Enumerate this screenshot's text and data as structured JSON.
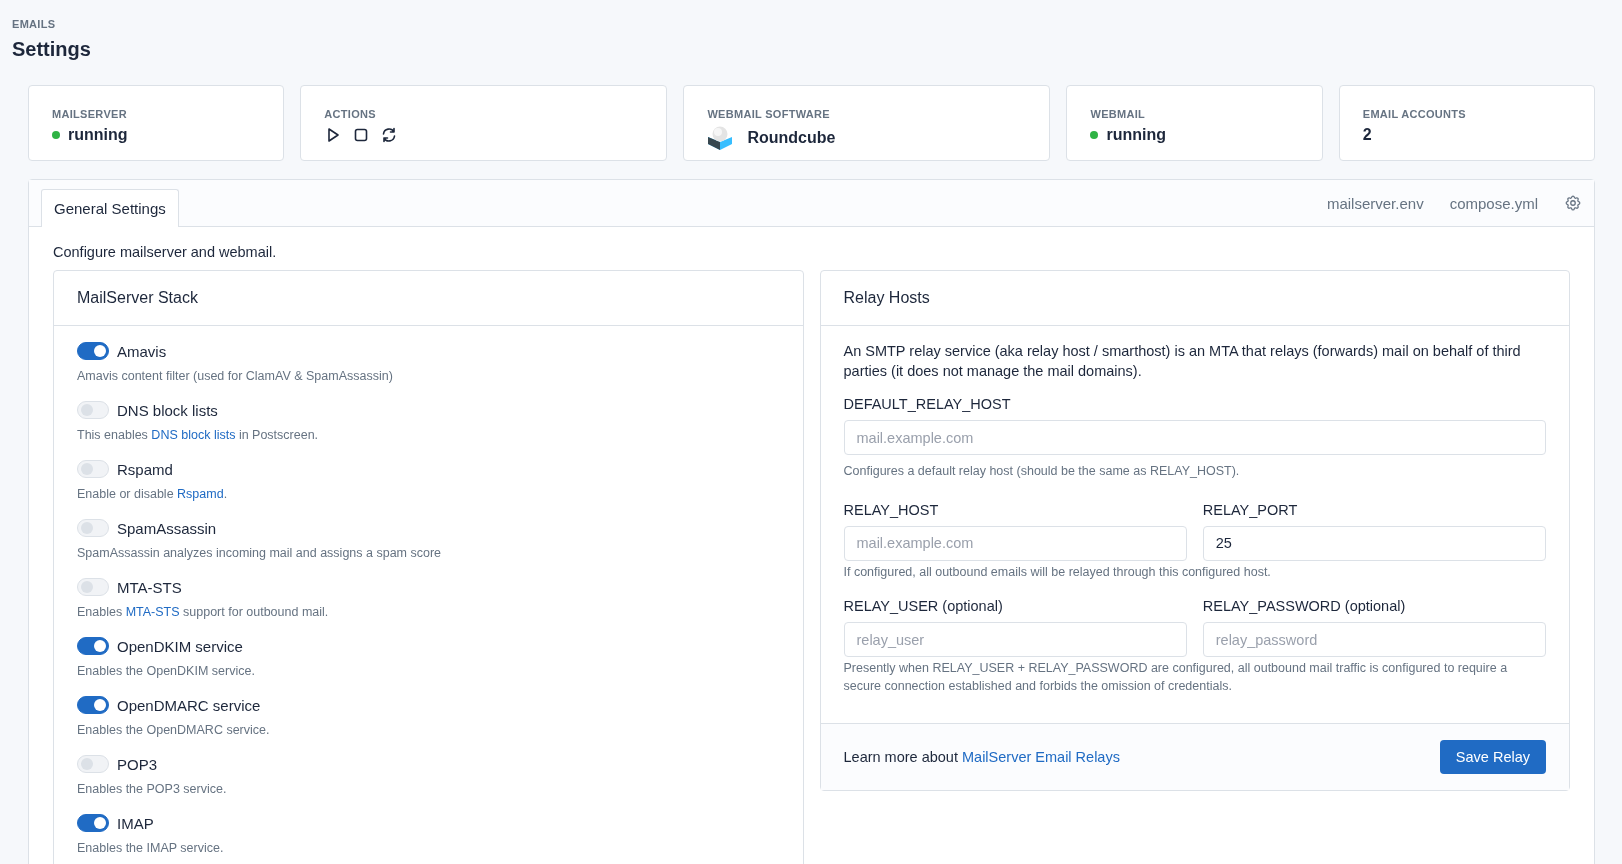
{
  "breadcrumb": "EMAILS",
  "title": "Settings",
  "stats": [
    {
      "kind": "status",
      "label": "MAILSERVER",
      "value": "running",
      "color": "#2fb344"
    },
    {
      "kind": "actions",
      "label": "ACTIONS"
    },
    {
      "kind": "software",
      "label": "WEBMAIL SOFTWARE",
      "value": "Roundcube"
    },
    {
      "kind": "status",
      "label": "WEBMAIL",
      "value": "running",
      "color": "#2fb344"
    },
    {
      "kind": "plain",
      "label": "EMAIL ACCOUNTS",
      "value": "2"
    }
  ],
  "tabs": [
    {
      "label": "General Settings",
      "selected": true
    }
  ],
  "tab_links": [
    "mailserver.env",
    "compose.yml"
  ],
  "intro": "Configure mailserver and webmail.",
  "stack": {
    "title": "MailServer Stack",
    "items": [
      {
        "name": "Amavis",
        "on": true,
        "description": [
          {
            "kind": "text",
            "text": "Amavis content filter (used for ClamAV & SpamAssassin)"
          }
        ]
      },
      {
        "name": "DNS block lists",
        "on": false,
        "description": [
          {
            "kind": "text",
            "text": "This enables "
          },
          {
            "kind": "link",
            "text": "DNS block lists"
          },
          {
            "kind": "text",
            "text": " in Postscreen."
          }
        ]
      },
      {
        "name": "Rspamd",
        "on": false,
        "description": [
          {
            "kind": "text",
            "text": "Enable or disable "
          },
          {
            "kind": "link",
            "text": "Rspamd"
          },
          {
            "kind": "text",
            "text": "."
          }
        ]
      },
      {
        "name": "SpamAssassin",
        "on": false,
        "description": [
          {
            "kind": "text",
            "text": "SpamAssassin analyzes incoming mail and assigns a spam score"
          }
        ]
      },
      {
        "name": "MTA-STS",
        "on": false,
        "description": [
          {
            "kind": "text",
            "text": "Enables "
          },
          {
            "kind": "link",
            "text": "MTA-STS"
          },
          {
            "kind": "text",
            "text": " support for outbound mail."
          }
        ]
      },
      {
        "name": "OpenDKIM service",
        "on": true,
        "description": [
          {
            "kind": "text",
            "text": "Enables the OpenDKIM service."
          }
        ]
      },
      {
        "name": "OpenDMARC service",
        "on": true,
        "description": [
          {
            "kind": "text",
            "text": "Enables the OpenDMARC service."
          }
        ]
      },
      {
        "name": "POP3",
        "on": false,
        "description": [
          {
            "kind": "text",
            "text": "Enables the POP3 service."
          }
        ]
      },
      {
        "name": "IMAP",
        "on": true,
        "description": [
          {
            "kind": "text",
            "text": "Enables the IMAP service."
          }
        ]
      }
    ]
  },
  "relay": {
    "title": "Relay Hosts",
    "intro": "An SMTP relay service (aka relay host / smarthost) is an MTA that relays (forwards) mail on behalf of third parties (it does not manage the mail domains).",
    "rows": [
      {
        "fields": [
          {
            "label": "DEFAULT_RELAY_HOST",
            "placeholder": "mail.example.com"
          }
        ],
        "help": "Configures a default relay host (should be the same as RELAY_HOST)."
      },
      {
        "fields": [
          {
            "label": "RELAY_HOST",
            "placeholder": "mail.example.com"
          },
          {
            "label": "RELAY_PORT",
            "value": "25"
          }
        ],
        "help": "If configured, all outbound emails will be relayed through this configured host."
      },
      {
        "fields": [
          {
            "label": "RELAY_USER (optional)",
            "placeholder": "relay_user"
          },
          {
            "label": "RELAY_PASSWORD (optional)",
            "placeholder": "relay_password"
          }
        ],
        "help": "Presently when RELAY_USER + RELAY_PASSWORD are configured, all outbound mail traffic is configured to require a secure connection established and forbids the omission of credentials."
      }
    ],
    "footer_text": "Learn more about ",
    "footer_link": "MailServer Email Relays",
    "button": "Save Relay"
  }
}
